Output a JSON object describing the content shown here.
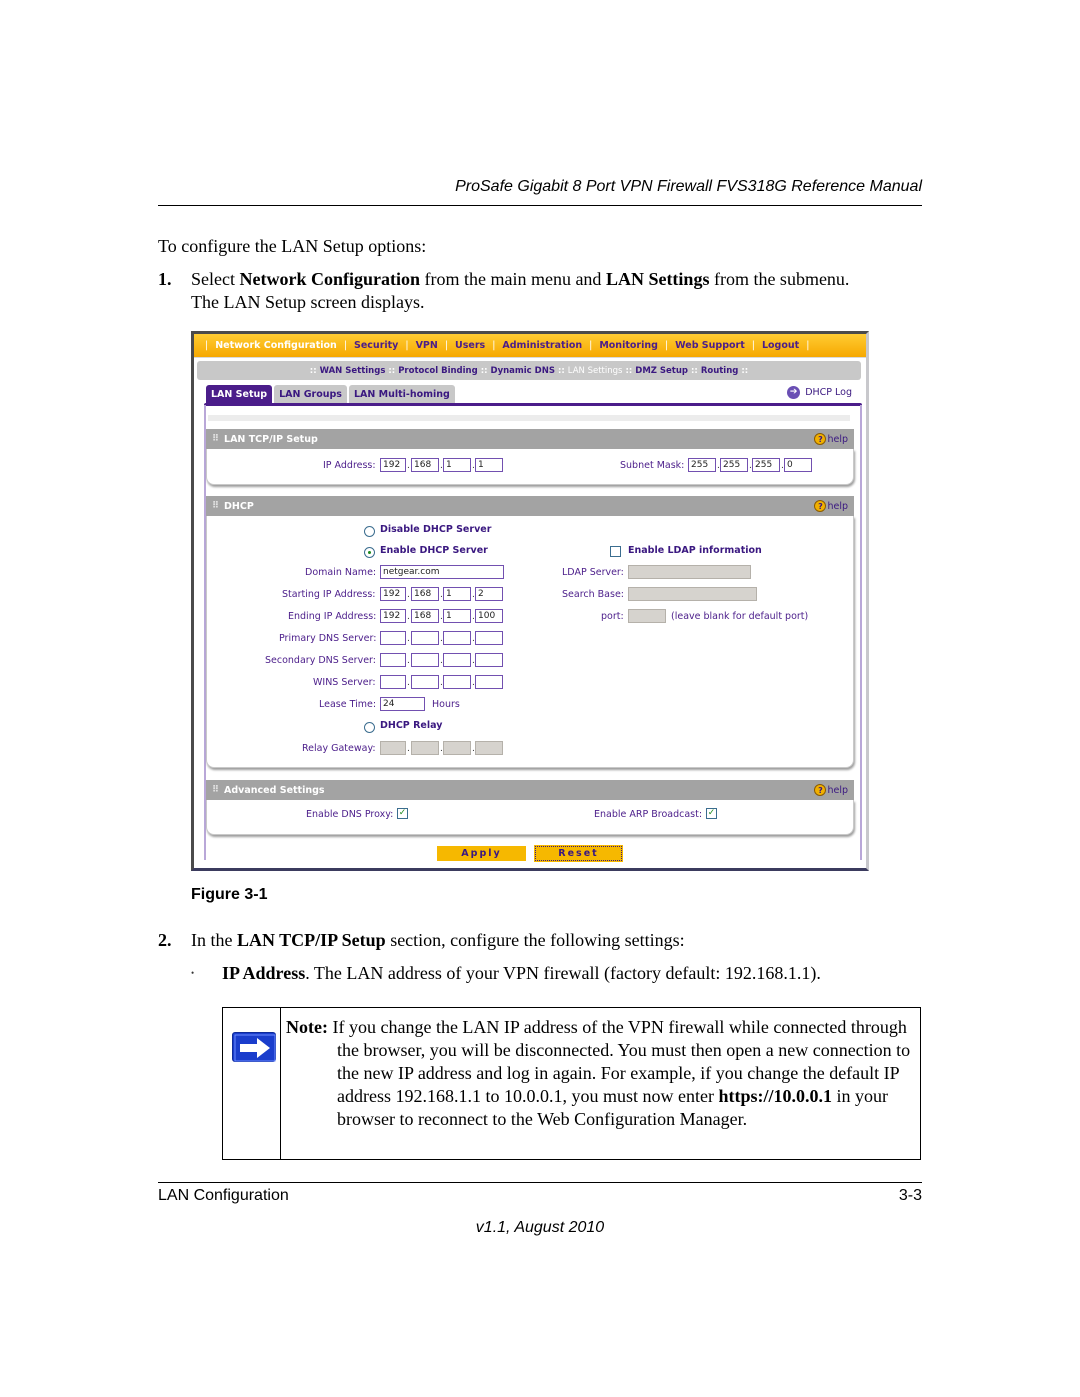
{
  "page": {
    "running_head": "ProSafe Gigabit 8 Port VPN Firewall FVS318G Reference Manual",
    "intro": "To configure the LAN Setup options:",
    "step1": {
      "number": "1.",
      "pre": "Select ",
      "bold1": "Network Configuration",
      "mid": " from the main menu and ",
      "bold2": "LAN Settings",
      "post": " from the submenu.",
      "line2": "The LAN Setup screen displays."
    },
    "figure_label": "Figure 3-1",
    "step2": {
      "number": "2.",
      "pre": "In the ",
      "bold": "LAN TCP/IP Setup",
      "post": " section, configure the following settings:"
    },
    "bullet": {
      "symbol": "•",
      "bold": "IP Address",
      "text": ". The LAN address of your VPN firewall (factory default: 192.168.1.1)."
    },
    "note": {
      "icon": "arrow-right-icon",
      "lead": "Note:",
      "line1": " If you change the LAN IP address of the VPN firewall while connected through the browser, you will be disconnected. You must then open a new connection to the new IP address and log in again. For example, if you change the default IP address 192.168.1.1 to 10.0.0.1, you must now enter ",
      "bold_url": "https://10.0.0.1",
      "line2": " in your browser to reconnect to the Web Configuration Manager."
    },
    "footer": {
      "left": "LAN Configuration",
      "right": "3-3",
      "version": "v1.1, August 2010"
    }
  },
  "screenshot": {
    "colors": {
      "menu": "#f6b800",
      "accent": "#4b1d8a",
      "section_header": "#a3a3a3"
    },
    "main_menu": [
      "Network Configuration",
      "Security",
      "VPN",
      "Users",
      "Administration",
      "Monitoring",
      "Web Support",
      "Logout"
    ],
    "main_menu_active": 0,
    "submenu": [
      "WAN Settings",
      "Protocol Binding",
      "Dynamic DNS",
      "LAN Settings",
      "DMZ Setup",
      "Routing"
    ],
    "submenu_active": 3,
    "tabs": [
      "LAN Setup",
      "LAN Groups",
      "LAN Multi-homing"
    ],
    "tab_active": 0,
    "dhcp_log": "DHCP Log",
    "help_label": "help",
    "lan_tcpip": {
      "title": "LAN TCP/IP Setup",
      "ip_label": "IP Address:",
      "ip": [
        "192",
        "168",
        "1",
        "1"
      ],
      "mask_label": "Subnet Mask:",
      "mask": [
        "255",
        "255",
        "255",
        "0"
      ]
    },
    "dhcp": {
      "title": "DHCP",
      "disable_label": "Disable DHCP Server",
      "enable_label": "Enable DHCP Server",
      "selected": "Enable DHCP Server",
      "domain_label": "Domain Name:",
      "domain": "netgear.com",
      "start_label": "Starting IP Address:",
      "start": [
        "192",
        "168",
        "1",
        "2"
      ],
      "end_label": "Ending IP Address:",
      "end": [
        "192",
        "168",
        "1",
        "100"
      ],
      "dns1_label": "Primary DNS Server:",
      "dns2_label": "Secondary DNS Server:",
      "wins_label": "WINS Server:",
      "lease_label": "Lease Time:",
      "lease": "24",
      "lease_unit": "Hours",
      "relay_label": "DHCP Relay",
      "relay_gw_label": "Relay Gateway:",
      "ldap_enable_label": "Enable LDAP information",
      "ldap_enabled": false,
      "ldap_server_label": "LDAP Server:",
      "search_base_label": "Search Base:",
      "port_label": "port:",
      "port_hint": "(leave blank for default port)"
    },
    "advanced": {
      "title": "Advanced Settings",
      "dns_proxy_label": "Enable DNS Proxy:",
      "dns_proxy": true,
      "arp_label": "Enable ARP Broadcast:",
      "arp": true
    },
    "buttons": {
      "apply": "Apply",
      "reset": "Reset"
    }
  }
}
